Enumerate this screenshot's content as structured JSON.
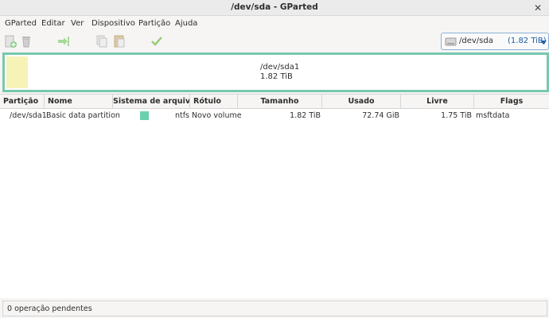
{
  "window": {
    "title": "/dev/sda - GParted"
  },
  "menu": [
    "GParted",
    "Editar",
    "Ver",
    "Dispositivo",
    "Partição",
    "Ajuda"
  ],
  "toolbar": {
    "icons": [
      "new-partition-icon",
      "delete-icon",
      "resize-move-icon",
      "copy-icon",
      "paste-icon",
      "apply-icon"
    ]
  },
  "device": {
    "name": "/dev/sda",
    "size": "(1.82 TiB)"
  },
  "diskmap": {
    "partition": "/dev/sda1",
    "size": "1.82 TiB",
    "used_fraction": 0.04
  },
  "table": {
    "headers": [
      "Partição",
      "Nome",
      "Sistema de arquivos",
      "Rótulo",
      "Tamanho",
      "Usado",
      "Livre",
      "Flags"
    ],
    "rows": [
      {
        "partition": "/dev/sda1",
        "name": "Basic data partition",
        "fs": "ntfs",
        "fs_color": "#6bd0ae",
        "label": "Novo volume",
        "size": "1.82 TiB",
        "used": "72.74 GiB",
        "free": "1.75 TiB",
        "flags": "msftdata"
      }
    ]
  },
  "status": "0 operação pendentes"
}
